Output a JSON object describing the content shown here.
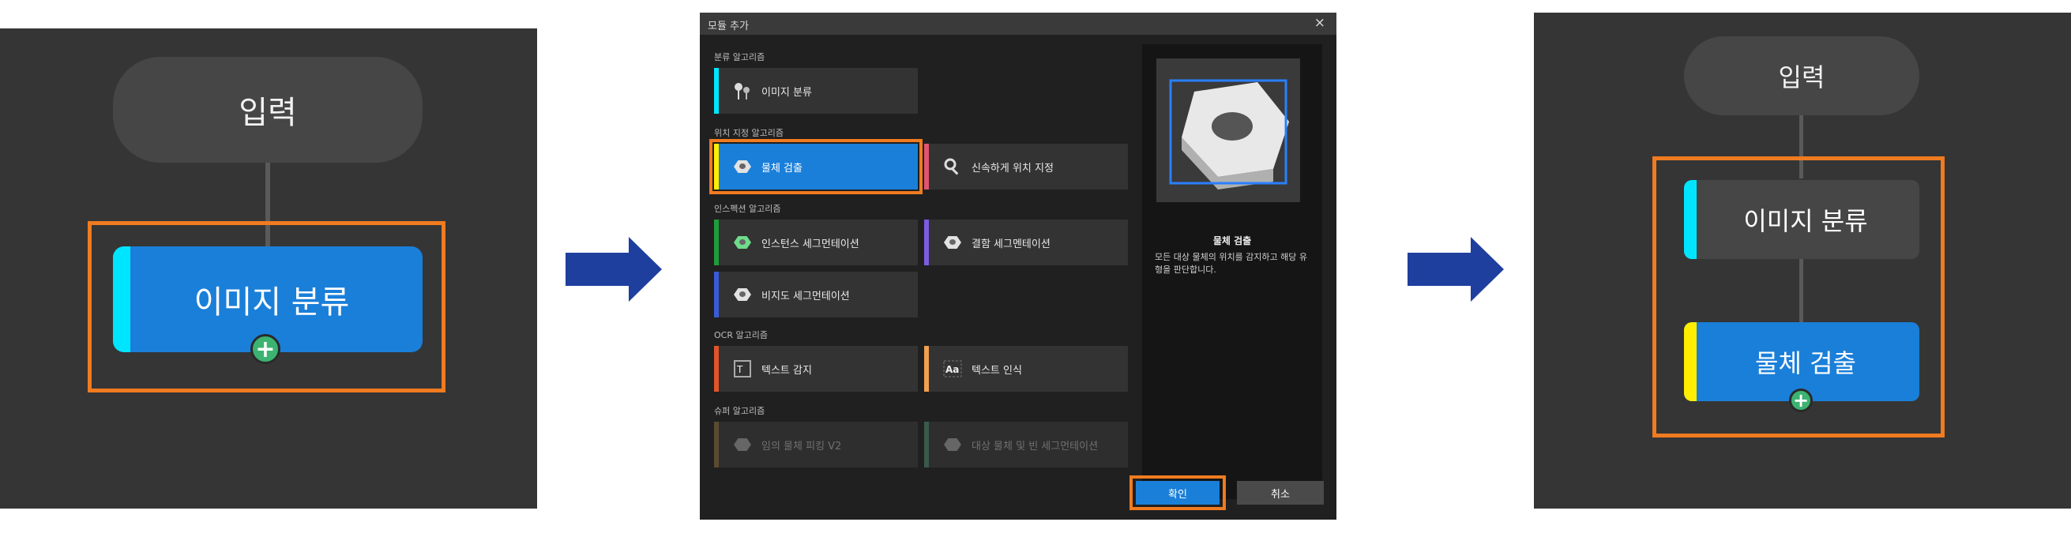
{
  "colors": {
    "panel_bg": "#353535",
    "node_blue": "#1a7fd9",
    "highlight_orange": "#f07b20",
    "arrow_blue": "#1f3f9e",
    "bar_cyan": "#00e5ff",
    "bar_yellow": "#ffee00",
    "plus_green": "#3cb371"
  },
  "left_panel": {
    "input_label": "입력",
    "node_label": "이미지 분류",
    "plus_symbol": "+"
  },
  "dialog": {
    "title": "모듈 추가",
    "close_symbol": "×",
    "sections": [
      {
        "label": "분류 알고리즘",
        "items": [
          {
            "label": "이미지 분류",
            "bar": "#00e5ff",
            "icon": "pin-icon",
            "state": "normal"
          }
        ]
      },
      {
        "label": "위치 지정 알고리즘",
        "items": [
          {
            "label": "물체 검출",
            "bar": "#ffee00",
            "icon": "nut-icon",
            "state": "selected"
          },
          {
            "label": "신속하게 위치 지정",
            "bar": "#e05570",
            "icon": "magnifier-icon",
            "state": "normal"
          }
        ]
      },
      {
        "label": "인스펙션 알고리즘",
        "items": [
          {
            "label": "인스턴스 세그먼테이션",
            "bar": "#1f9e3a",
            "icon": "nut-green-icon",
            "state": "normal"
          },
          {
            "label": "결함 세그멘테이션",
            "bar": "#7d5be0",
            "icon": "nut-defect-icon",
            "state": "normal"
          },
          {
            "label": "비지도 세그먼테이션",
            "bar": "#3a5bd9",
            "icon": "nut-icon",
            "state": "normal"
          }
        ]
      },
      {
        "label": "OCR 알고리즘",
        "items": [
          {
            "label": "텍스트 감지",
            "bar": "#e0542a",
            "icon": "text-detect-icon",
            "state": "normal"
          },
          {
            "label": "텍스트 인식",
            "bar": "#f0a050",
            "icon": "text-recognize-icon",
            "state": "normal"
          }
        ]
      },
      {
        "label": "슈퍼 알고리즘",
        "items": [
          {
            "label": "임의 물체 피킹 V2",
            "bar": "#5a4a30",
            "icon": "pick-icon",
            "state": "disabled"
          },
          {
            "label": "대상 물체 및 빈 세그먼테이션",
            "bar": "#3a5a4a",
            "icon": "bin-icon",
            "state": "disabled"
          }
        ]
      }
    ],
    "preview": {
      "title": "물체 검출",
      "description": "모든 대상 물체의 위치를 감지하고 해당 유형을 판단합니다."
    },
    "ok_label": "확인",
    "cancel_label": "취소"
  },
  "right_panel": {
    "input_label": "입력",
    "node1_label": "이미지 분류",
    "node2_label": "물체 검출",
    "plus_symbol": "+"
  }
}
